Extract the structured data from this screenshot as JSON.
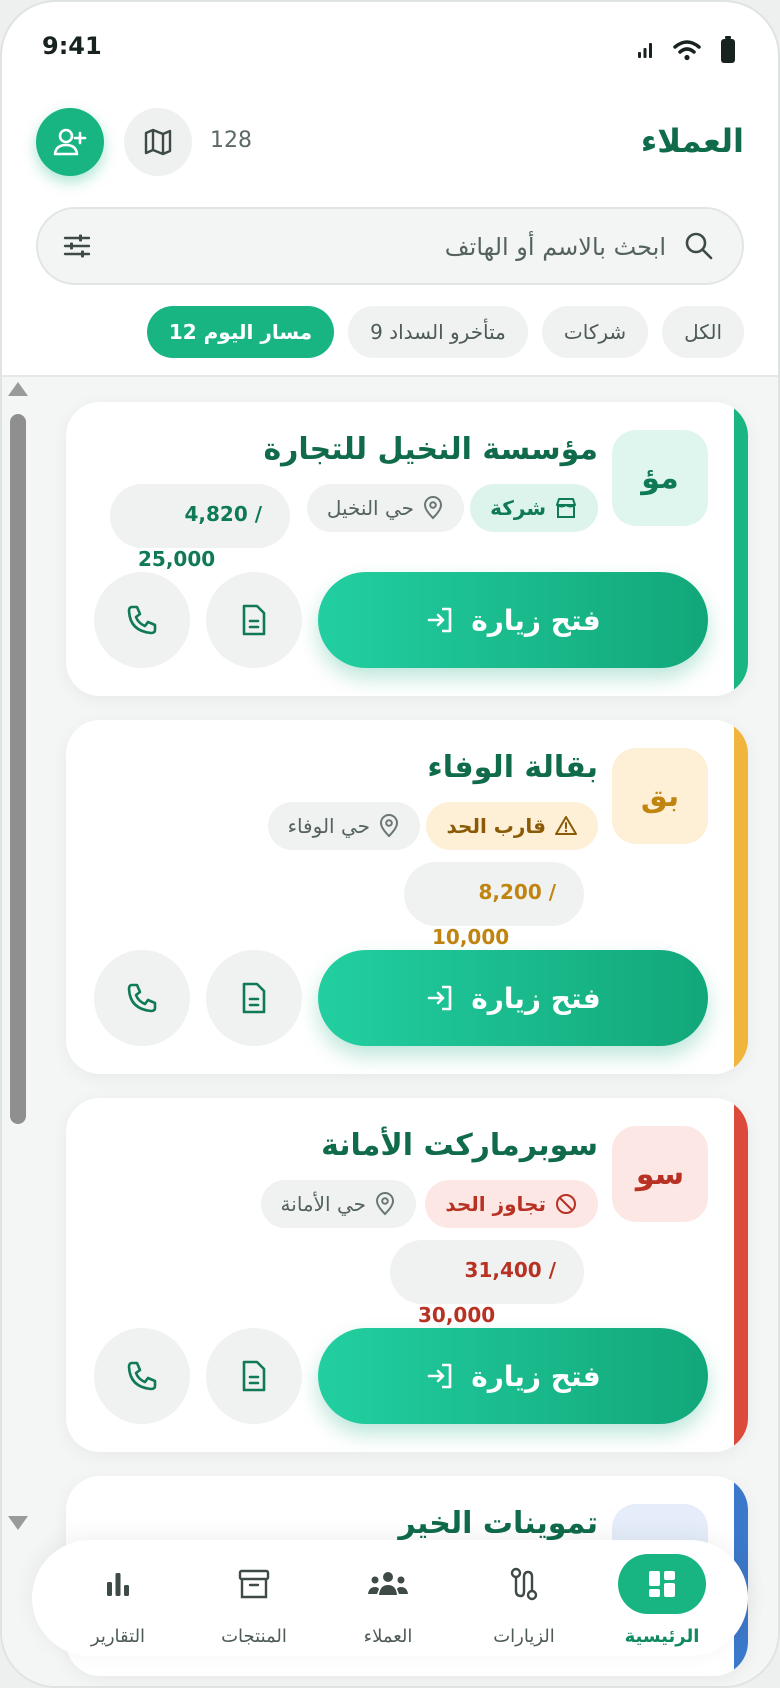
{
  "status_bar": {
    "time": "9:41"
  },
  "header": {
    "title": "العملاء",
    "count": "128"
  },
  "search": {
    "placeholder": "ابحث بالاسم أو الهاتف"
  },
  "chips": [
    {
      "label": "مسار اليوم 12",
      "active": true
    },
    {
      "label": "متأخرو السداد 9",
      "active": false
    },
    {
      "label": "شركات",
      "active": false
    },
    {
      "label": "الكل",
      "active": false
    }
  ],
  "customers": [
    {
      "initials": "مؤ",
      "name": "مؤسسة النخيل للتجارة",
      "tag": "شركة",
      "district": "حي النخيل",
      "balance": "4,820 /",
      "limit": "25,000",
      "accent": "#19b582"
    },
    {
      "initials": "بق",
      "name": "بقالة الوفاء",
      "tag": "قارب الحد",
      "district": "حي الوفاء",
      "balance": "8,200 /",
      "limit": "10,000",
      "accent": "#f1b43c"
    },
    {
      "initials": "سو",
      "name": "سوبرماركت الأمانة",
      "tag": "تجاوز الحد",
      "district": "حي الأمانة",
      "balance": "31,400 /",
      "limit": "30,000",
      "accent": "#db4a3a"
    },
    {
      "name": "تموينات الخير",
      "accent": "#3c78c9"
    }
  ],
  "visit_label": "فتح زيارة",
  "nav": [
    {
      "label": "الرئيسية",
      "icon": "dashboard-icon",
      "active": true
    },
    {
      "label": "الزيارات",
      "icon": "route-icon",
      "active": false
    },
    {
      "label": "العملاء",
      "icon": "users-icon",
      "active": false
    },
    {
      "label": "المنتجات",
      "icon": "archive-icon",
      "active": false
    },
    {
      "label": "التقارير",
      "icon": "bar-chart-icon",
      "active": false
    }
  ]
}
